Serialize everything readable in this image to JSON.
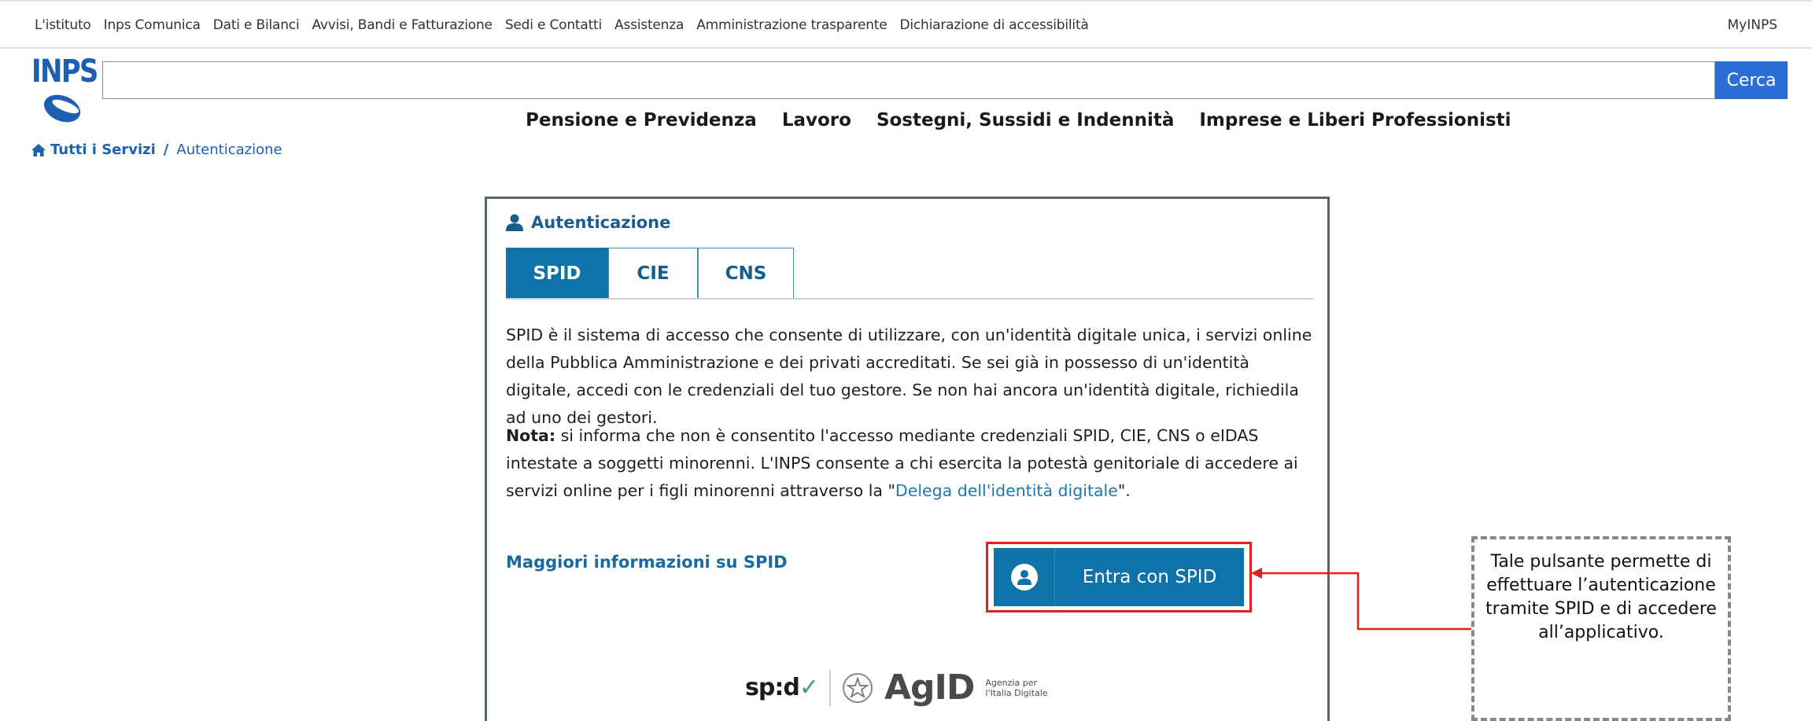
{
  "topbar": {
    "links": [
      "L'istituto",
      "Inps Comunica",
      "Dati e Bilanci",
      "Avvisi, Bandi e Fatturazione",
      "Sedi e Contatti",
      "Assistenza",
      "Amministrazione trasparente",
      "Dichiarazione di accessibilità"
    ],
    "myinps": "MyINPS"
  },
  "logo": {
    "text": "INPS",
    "color": "#1d5fb0"
  },
  "search": {
    "value": "",
    "placeholder": "",
    "button_label": "Cerca",
    "button_color": "#2b6fd6"
  },
  "mainnav": [
    "Pensione e Previdenza",
    "Lavoro",
    "Sostegni, Sussidi e Indennità",
    "Imprese e Liberi Professionisti"
  ],
  "breadcrumb": {
    "home": "Tutti i Servizi",
    "separator": "/",
    "current": "Autenticazione"
  },
  "auth": {
    "title": "Autenticazione",
    "tabs": [
      {
        "label": "SPID",
        "active": true
      },
      {
        "label": "CIE",
        "active": false
      },
      {
        "label": "CNS",
        "active": false
      }
    ],
    "description": "SPID è il sistema di accesso che consente di utilizzare, con un'identità digitale unica, i servizi online della Pubblica Amministrazione e dei privati accreditati. Se sei già in possesso di un'identità digitale, accedi con le credenziali del tuo gestore. Se non hai ancora un'identità digitale, richiedila ad uno dei gestori.",
    "note_label": "Nota:",
    "note_text": " si informa che non è consentito l'accesso mediante credenziali SPID, CIE, CNS o eIDAS intestate a soggetti minorenni. L'INPS consente a chi esercita la potestà genitoriale di accedere ai servizi online per i figli minorenni attraverso la \"",
    "note_link": "Delega dell'identità digitale",
    "note_end": "\".",
    "more_info": "Maggiori informazioni su SPID",
    "spid_button": "Entra con SPID",
    "primary_color": "#0f72a8",
    "highlight_color": "#e21e1e",
    "spid_logo_text": "sp:d",
    "agid_logo_text": "AgID",
    "agid_sub_line1": "Agenzia per",
    "agid_sub_line2": "l'Italia Digitale"
  },
  "annotation": {
    "text": "Tale pulsante permette di effettuare l’autenticazione tramite SPID e di accedere all’applicativo."
  }
}
